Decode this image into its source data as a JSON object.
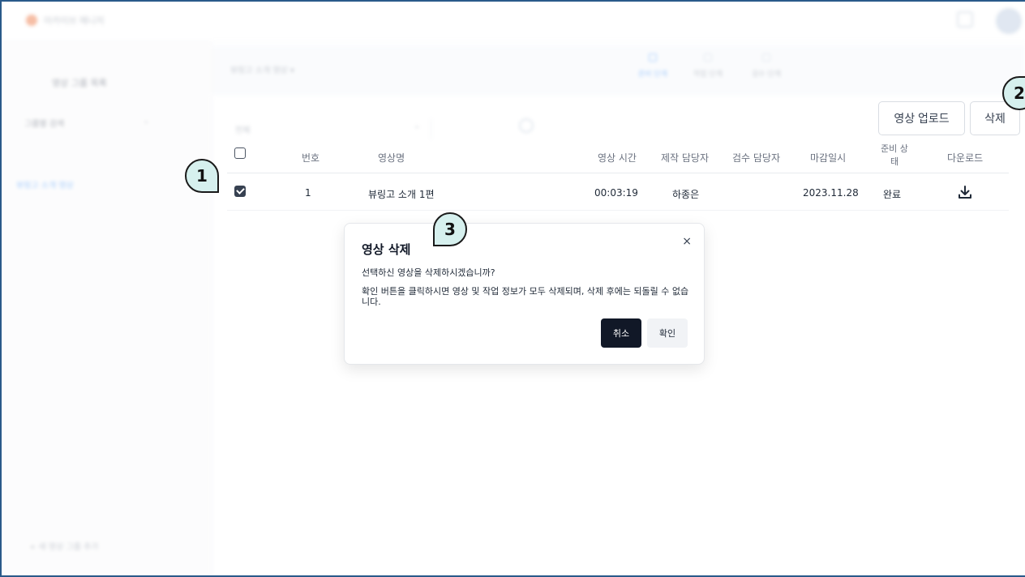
{
  "app": {
    "logo_text": "아카이브 매니저"
  },
  "sidebar": {
    "title": "영상 그룹 목록",
    "group_label": "그룹별 검색",
    "active_item": "뷰링고 소개 영상",
    "bottom_link": "+ 새 영상 그룹 추가"
  },
  "breadcrumb": {
    "text": "뷰링고 소개 영상 ▾",
    "stages": [
      "준비 단계",
      "작업 단계",
      "검수 단계"
    ]
  },
  "filter": {
    "select_label": "전체",
    "chevron": "⌄"
  },
  "toolbar": {
    "upload_label": "영상 업로드",
    "delete_label": "삭제"
  },
  "table": {
    "headers": {
      "number": "번호",
      "title": "영상명",
      "duration": "영상 시간",
      "producer": "제작 담당자",
      "reviewer": "검수 담당자",
      "deadline": "마감일시",
      "ready_status": "준비 상태",
      "download": "다운로드"
    },
    "rows": [
      {
        "number": "1",
        "title": "뷰링고 소개 1편",
        "duration": "00:03:19",
        "producer": "하종은",
        "reviewer": "",
        "deadline": "2023.11.28",
        "ready_status": "완료",
        "checked": true
      }
    ]
  },
  "modal": {
    "title": "영상 삭제",
    "close": "×",
    "line1": "선택하신 영상을 삭제하시겠습니까?",
    "line2": "확인 버튼을 클릭하시면 영상 및 작업 정보가 모두 삭제되며, 삭제 후에는 되돌릴 수 없습니다.",
    "cancel_label": "취소",
    "confirm_label": "확인"
  },
  "callouts": [
    "1",
    "2",
    "3"
  ],
  "colors": {
    "callout_fill": "#d6f0ee",
    "primary_dark": "#111827",
    "accent_blue": "#60a5fa"
  }
}
